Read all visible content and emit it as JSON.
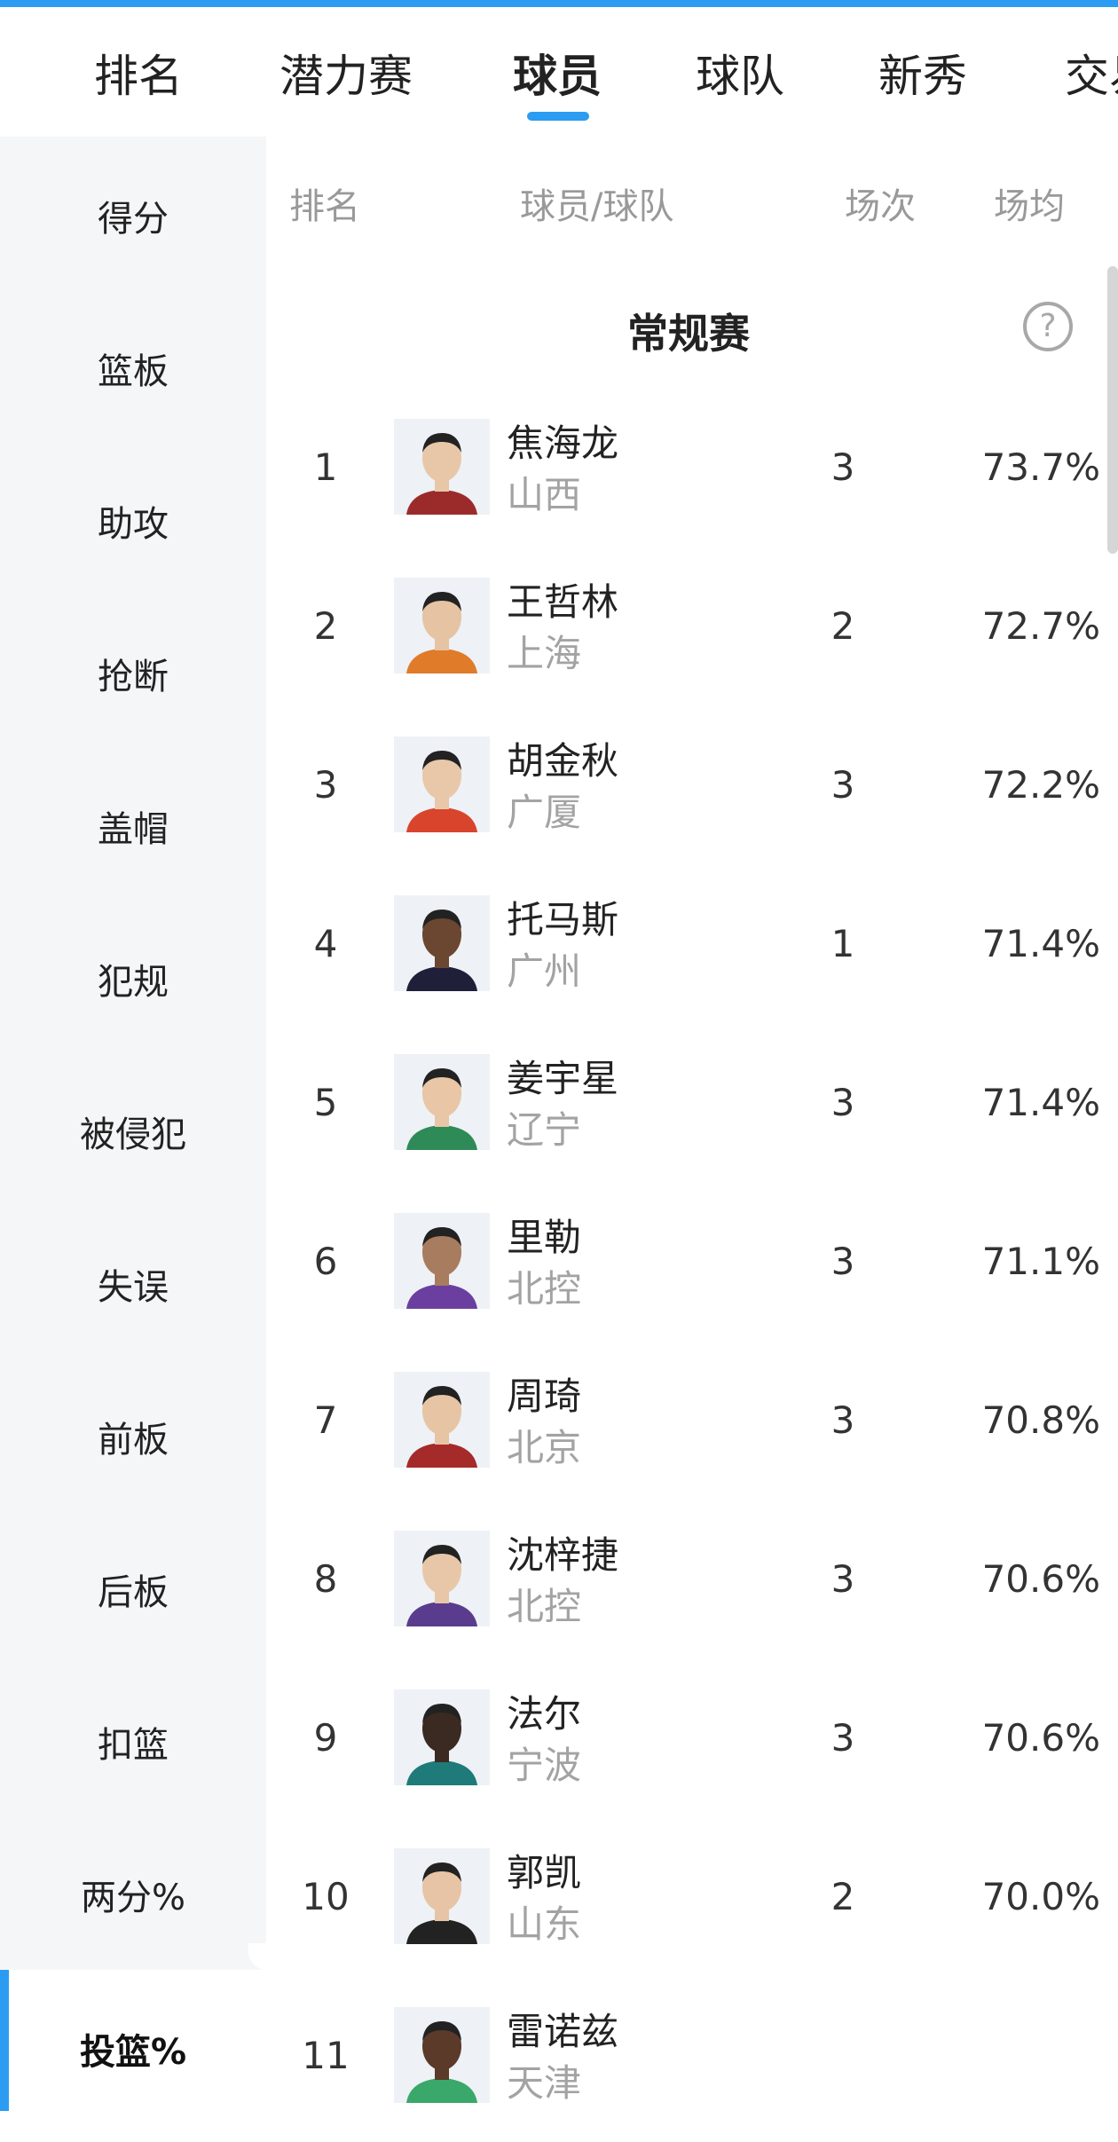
{
  "tabs": [
    {
      "label": "排名"
    },
    {
      "label": "潜力赛"
    },
    {
      "label": "球员"
    },
    {
      "label": "球队"
    },
    {
      "label": "新秀"
    },
    {
      "label": "交易"
    }
  ],
  "active_tab": "球员",
  "sidebar": {
    "items": [
      {
        "label": "得分"
      },
      {
        "label": "篮板"
      },
      {
        "label": "助攻"
      },
      {
        "label": "抢断"
      },
      {
        "label": "盖帽"
      },
      {
        "label": "犯规"
      },
      {
        "label": "被侵犯"
      },
      {
        "label": "失误"
      },
      {
        "label": "前板"
      },
      {
        "label": "后板"
      },
      {
        "label": "扣篮"
      },
      {
        "label": "两分%"
      },
      {
        "label": "投篮%"
      }
    ],
    "active": "投篮%"
  },
  "table": {
    "headers": {
      "rank": "排名",
      "player": "球员/球队",
      "games": "场次",
      "avg": "场均"
    },
    "section_title": "常规赛",
    "help_icon": "question-circle-icon",
    "rows": [
      {
        "rank": "1",
        "name": "焦海龙",
        "team": "山西",
        "games": "3",
        "pct": "73.7%"
      },
      {
        "rank": "2",
        "name": "王哲林",
        "team": "上海",
        "games": "2",
        "pct": "72.7%"
      },
      {
        "rank": "3",
        "name": "胡金秋",
        "team": "广厦",
        "games": "3",
        "pct": "72.2%"
      },
      {
        "rank": "4",
        "name": "托马斯",
        "team": "广州",
        "games": "1",
        "pct": "71.4%"
      },
      {
        "rank": "5",
        "name": "姜宇星",
        "team": "辽宁",
        "games": "3",
        "pct": "71.4%"
      },
      {
        "rank": "6",
        "name": "里勒",
        "team": "北控",
        "games": "3",
        "pct": "71.1%"
      },
      {
        "rank": "7",
        "name": "周琦",
        "team": "北京",
        "games": "3",
        "pct": "70.8%"
      },
      {
        "rank": "8",
        "name": "沈梓捷",
        "team": "北控",
        "games": "3",
        "pct": "70.6%"
      },
      {
        "rank": "9",
        "name": "法尔",
        "team": "宁波",
        "games": "3",
        "pct": "70.6%"
      },
      {
        "rank": "10",
        "name": "郭凯",
        "team": "山东",
        "games": "2",
        "pct": "70.0%"
      },
      {
        "rank": "11",
        "name": "雷诺兹",
        "team": "天津",
        "games": "",
        "pct": ""
      }
    ]
  },
  "colors": {
    "accent": "#2b9cf2",
    "sidebar_bg": "#f5f6f8",
    "muted_text": "#999999"
  }
}
